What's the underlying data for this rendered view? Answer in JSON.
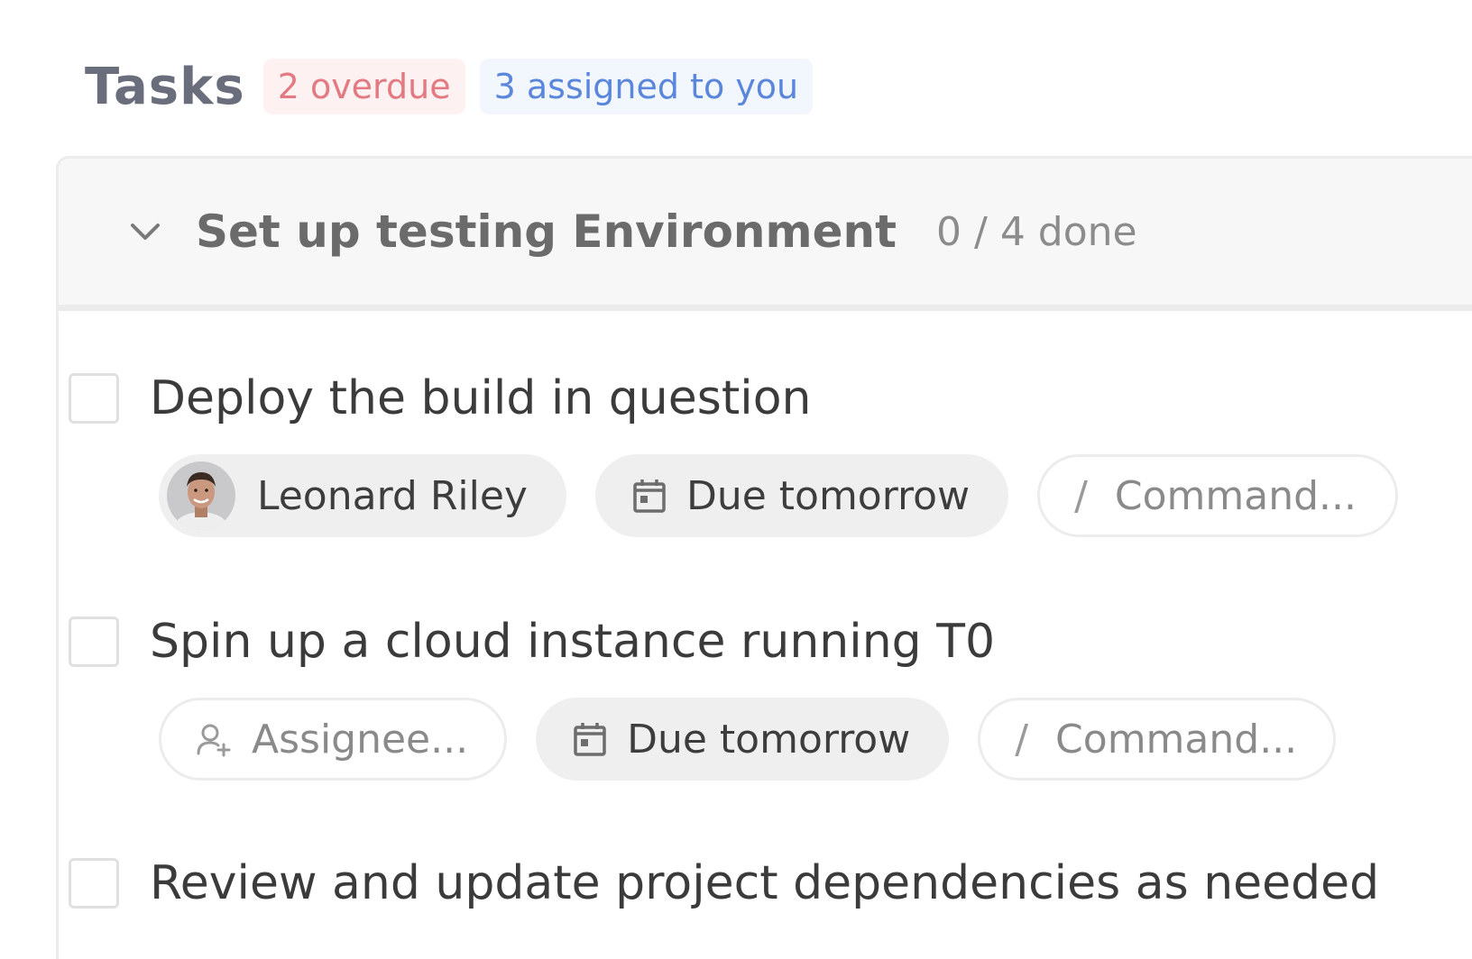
{
  "header": {
    "title": "Tasks",
    "overdue_badge": "2 overdue",
    "assigned_badge": "3 assigned to you"
  },
  "group": {
    "title": "Set up testing Environment",
    "progress": "0 / 4 done"
  },
  "tasks": [
    {
      "title": "Deploy the build in question",
      "assignee": "Leonard Riley",
      "due": "Due tomorrow",
      "command": "Command..."
    },
    {
      "title": "Spin up a cloud instance running T0",
      "assignee_placeholder": "Assignee...",
      "due": "Due tomorrow",
      "command": "Command..."
    },
    {
      "title": "Review and update project dependencies as needed"
    }
  ],
  "command_prefix": "/",
  "icons": {
    "collapse": "chevron-down-icon",
    "calendar": "calendar-icon",
    "add_assignee": "add-person-icon"
  },
  "colors": {
    "overdue_text": "#e37a82",
    "overdue_bg": "#fdf1f2",
    "assigned_text": "#5a86dc",
    "assigned_bg": "#f2f6fd"
  }
}
